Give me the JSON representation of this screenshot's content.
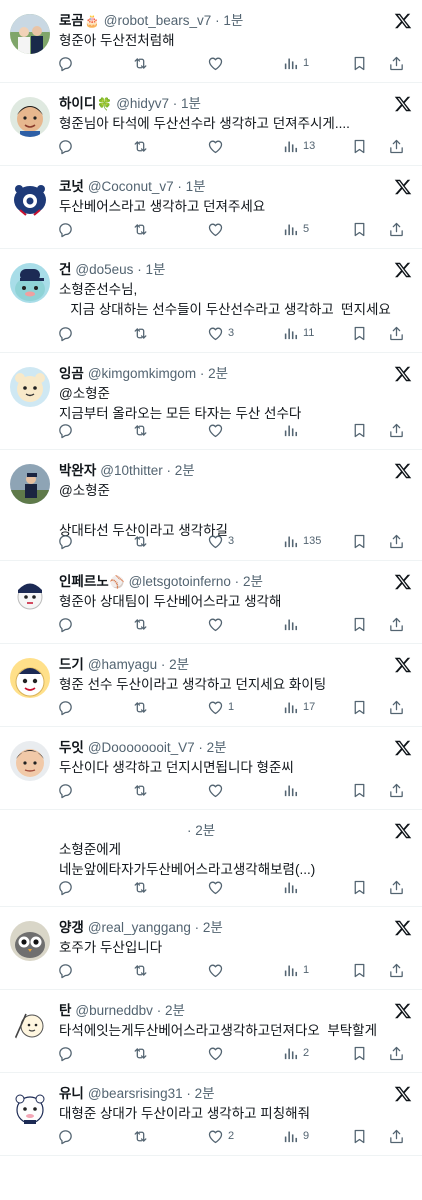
{
  "colors": {
    "text": "#0f1419",
    "secondary": "#536471",
    "divider": "#eff3f4",
    "background": "#ffffff"
  },
  "icons": {
    "reply": "reply-icon",
    "retweet": "retweet-icon",
    "like": "like-icon",
    "views": "views-icon",
    "bookmark": "bookmark-icon",
    "share": "share-icon",
    "more": "x-logo-icon"
  },
  "tweets": [
    {
      "name": "로곰",
      "name_icon": "🎂",
      "handle": "@robot_bears_v7",
      "dot": "·",
      "time": "1분",
      "text": "형준아 두산전처럼해",
      "replies": "",
      "retweets": "",
      "likes": "",
      "views": "1"
    },
    {
      "name": "하이디",
      "name_icon": "🍀",
      "handle": "@hidyv7",
      "dot": "·",
      "time": "1분",
      "text": "형준님아 타석에 두산선수라 생각하고 던져주시게....",
      "replies": "",
      "retweets": "",
      "likes": "",
      "views": "13"
    },
    {
      "name": "코넛",
      "name_icon": "",
      "handle": "@Coconut_v7",
      "dot": "·",
      "time": "1분",
      "text": "두산베어스라고 생각하고 던져주세요",
      "replies": "",
      "retweets": "",
      "likes": "",
      "views": "5"
    },
    {
      "name": "건",
      "name_icon": "",
      "handle": "@do5eus",
      "dot": "·",
      "time": "1분",
      "text": "소형준선수님,\n   지금 상대하는 선수들이 두산선수라고 생각하고  떤지세요",
      "replies": "",
      "retweets": "",
      "likes": "3",
      "views": "11"
    },
    {
      "name": "잉곰",
      "name_icon": "",
      "handle": "@kimgomkimgom",
      "dot": "·",
      "time": "2분",
      "text": "@소형준\n지금부터 올라오는 모든 타자는 두산 선수다",
      "replies": "",
      "retweets": "",
      "likes": "",
      "views": ""
    },
    {
      "name": "박완자",
      "name_icon": "",
      "handle": "@10thitter",
      "dot": "·",
      "time": "2분",
      "text": "@소형준\n\n상대타선 두산이라고 생각하길",
      "replies": "",
      "retweets": "",
      "likes": "3",
      "views": "135"
    },
    {
      "name": "인페르노",
      "name_icon": "⚾",
      "handle": "@letsgotoinferno",
      "dot": "·",
      "time": "2분",
      "text": "형준아 상대팀이 두산베어스라고 생각해",
      "replies": "",
      "retweets": "",
      "likes": "",
      "views": ""
    },
    {
      "name": "드기",
      "name_icon": "",
      "handle": "@hamyagu",
      "dot": "·",
      "time": "2분",
      "text": "형준 선수 두산이라고 생각하고 던지세요 화이팅",
      "replies": "",
      "retweets": "",
      "likes": "1",
      "views": "17"
    },
    {
      "name": "두잇",
      "name_icon": "",
      "handle": "@Doooooooit_V7",
      "dot": "·",
      "time": "2분",
      "text": "두산이다 생각하고 던지시면됩니다 형준씨",
      "replies": "",
      "retweets": "",
      "likes": "",
      "views": ""
    },
    {
      "name": "",
      "name_icon": "",
      "handle": "",
      "dot": "·",
      "time": "2분",
      "text": "소형준에게\n네눈앞에타자가두산베어스라고생각해보렴(...)",
      "replies": "",
      "retweets": "",
      "likes": "",
      "views": ""
    },
    {
      "name": "양갱",
      "name_icon": "",
      "handle": "@real_yanggang",
      "dot": "·",
      "time": "2분",
      "text": "호주가 두산입니다",
      "replies": "",
      "retweets": "",
      "likes": "",
      "views": "1"
    },
    {
      "name": "탄",
      "name_icon": "",
      "handle": "@burneddbv",
      "dot": "·",
      "time": "2분",
      "text": "타석에잇는게두산베어스라고생각하고던져다오  부탁할게",
      "replies": "",
      "retweets": "",
      "likes": "",
      "views": "2"
    },
    {
      "name": "유니",
      "name_icon": "",
      "handle": "@bearsrising31",
      "dot": "·",
      "time": "2분",
      "text": "대형준 상대가 두산이라고 생각하고 피칭해줘",
      "replies": "",
      "retweets": "",
      "likes": "2",
      "views": "9"
    }
  ]
}
